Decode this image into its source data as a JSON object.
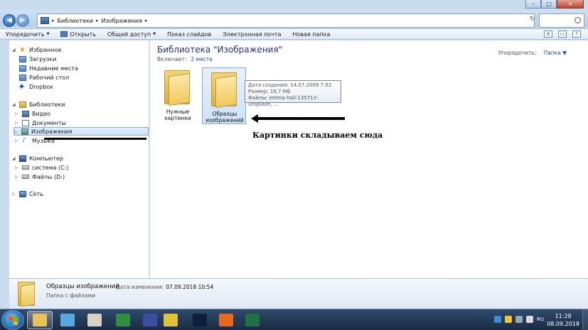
{
  "window": {
    "controls": {
      "minimize": "–",
      "maximize": "□",
      "close": "✕"
    }
  },
  "nav": {
    "back": "◀",
    "forward": "▶",
    "dropdown": "▾"
  },
  "address": {
    "crumbs": [
      "Библиотеки",
      "Изображения"
    ],
    "separator": "▸",
    "refresh": "↻"
  },
  "search": {
    "placeholder": ""
  },
  "toolbar": {
    "organize": "Упорядочить",
    "open": "Открыть",
    "share": "Общий доступ",
    "slideshow": "Показ слайдов",
    "email": "Электронная почта",
    "new_folder": "Новая папка",
    "arrow": "▼",
    "view_icon": "≡",
    "preview_icon": "▭",
    "help_icon": "?"
  },
  "navpane": {
    "favorites": {
      "label": "Избранное",
      "items": [
        "Загрузки",
        "Недавние места",
        "Рабочий стол",
        "Dropbox"
      ]
    },
    "libraries": {
      "label": "Библиотеки",
      "items": [
        "Видео",
        "Документы",
        "Изображения",
        "Музыка"
      ]
    },
    "computer": {
      "label": "Компьютер",
      "items": [
        "система (C:)",
        "Файлы (D:)"
      ]
    },
    "network": {
      "label": "Сеть"
    },
    "expand_glyph": "▷",
    "collapse_glyph": "◢",
    "star_glyph": "★",
    "dropbox_glyph": "◆",
    "music_glyph": "♪"
  },
  "content": {
    "title": "Библиотека \"Изображения\"",
    "includes_label": "Включает:",
    "includes_value": "2 места",
    "arrange_label": "Упорядочить:",
    "arrange_value": "Папка",
    "arrange_arrow": "▼",
    "folders": [
      {
        "label": "Нужные картинки"
      },
      {
        "label": "Образцы изображений"
      }
    ],
    "tooltip": {
      "created": "Дата создания: 14.07.2009 7:52",
      "size": "Размер: 19,7 МБ",
      "files": "Файлы: emma-hall-135713-unsplash, ..."
    },
    "annotation": "Картинки складываем сюда"
  },
  "details": {
    "name": "Образцы изображений",
    "date_label": "Дата изменения:",
    "date_value": "07.09.2018 10:54",
    "type": "Папка с файлами"
  },
  "taskbar": {
    "apps": [
      {
        "name": "explorer",
        "color": "#e8c35a"
      },
      {
        "name": "windows-media",
        "color": "#5aa7e0"
      },
      {
        "name": "paint",
        "color": "#d8d2c4"
      },
      {
        "name": "excel-green",
        "color": "#2f8f3e"
      },
      {
        "name": "save-disk",
        "color": "#3b4fa0"
      },
      {
        "name": "chrome",
        "color": "#e0c23a"
      },
      {
        "name": "photoshop",
        "color": "#0b2236"
      },
      {
        "name": "firefox",
        "color": "#e56a1f"
      },
      {
        "name": "excel",
        "color": "#207245"
      }
    ],
    "lang": "RU",
    "time": "11:28",
    "date": "08.09.2018"
  }
}
